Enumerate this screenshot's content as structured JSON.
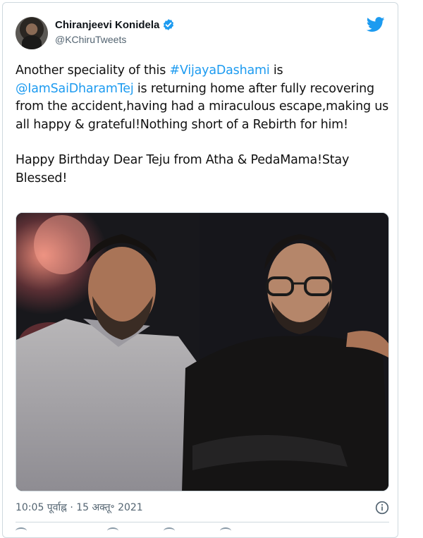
{
  "tweet": {
    "author": {
      "display_name": "Chiranjeevi Konidela",
      "handle": "@KChiruTweets"
    },
    "text_parts": [
      "Another speciality of this ",
      "#VijayaDashami",
      " is ",
      "@IamSaiDharamTej",
      " is returning home after fully recovering from the accident,having had a miraculous escape,making us all happy & grateful!Nothing short of a Rebirth for him!"
    ],
    "text_second": "Happy Birthday Dear Teju from Atha & PedaMama!Stay Blessed!",
    "timestamp": "10:05 पूर्वाह्न · 15 अक्तू॰ 2021"
  },
  "colors": {
    "link": "#1d9bf0",
    "verified": "#1d9bf0",
    "twitter": "#1d9bf0"
  },
  "icons": [
    "verified-icon",
    "twitter-bird-icon",
    "info-icon"
  ]
}
